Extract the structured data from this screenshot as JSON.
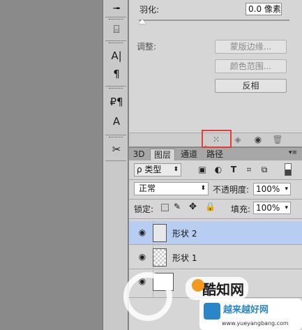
{
  "toolbar": {
    "tools": [
      {
        "icon": "bucket-icon",
        "glyph": "╼"
      },
      {
        "icon": "stamp-icon",
        "glyph": "⌸"
      },
      {
        "icon": "character-icon",
        "glyph": "A|"
      },
      {
        "icon": "paragraph-icon",
        "glyph": "¶"
      },
      {
        "icon": "paragraph-styles-icon",
        "glyph": "₽¶"
      },
      {
        "icon": "character-styles-icon",
        "glyph": "A"
      },
      {
        "icon": "tool-presets-icon",
        "glyph": "✂"
      }
    ]
  },
  "properties": {
    "feather_label": "羽化:",
    "feather_value": "0.0 像素",
    "adjust_label": "调整:",
    "buttons": [
      "蒙版边缘...",
      "颜色范围...",
      "反相"
    ],
    "accent_border": "#e23b3b"
  },
  "layers_panel": {
    "tabs": [
      "3D",
      "图层",
      "通道",
      "路径"
    ],
    "active_tab_index": 1,
    "filter_select": "ρ 类型",
    "blend_mode": "正常",
    "opacity_label": "不透明度:",
    "opacity_value": "100%",
    "lock_label": "锁定:",
    "fill_label": "填充:",
    "fill_value": "100%",
    "layers": [
      {
        "name": "形状 2",
        "selected": true
      },
      {
        "name": "形状 1",
        "selected": false
      },
      {
        "name": "",
        "selected": false
      }
    ],
    "selection_color": "#b7cdf2"
  },
  "watermark": {
    "brand_text": "酷知网",
    "badge_title": "越来越好网",
    "badge_url": "www.yueyangbang.com"
  }
}
